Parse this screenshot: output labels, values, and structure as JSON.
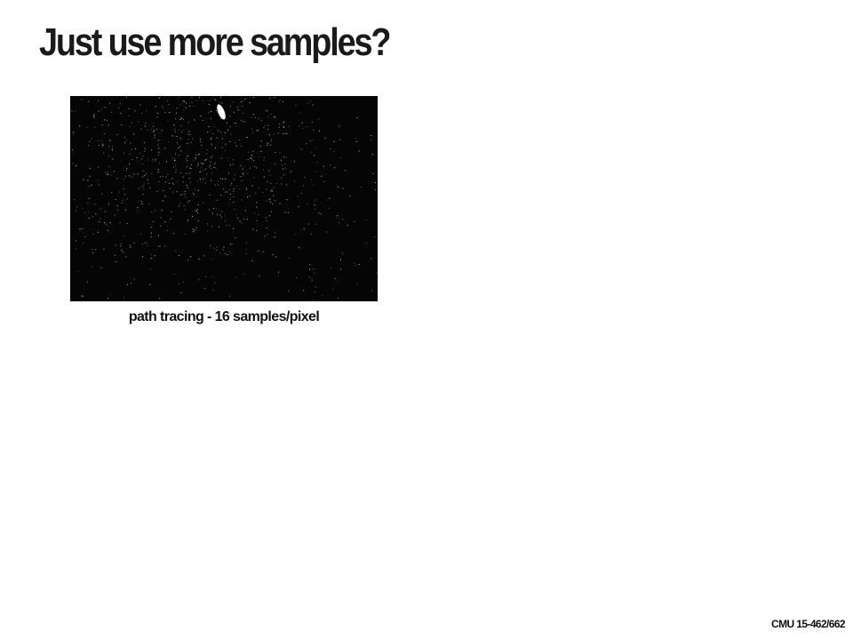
{
  "slide": {
    "title": "Just use more samples?",
    "caption": "path tracing - 16 samples/pixel",
    "footer": "CMU 15-462/662"
  },
  "image": {
    "description_icon": "noisy-path-traced-render",
    "background_color": "#050505",
    "noise_color": "#d8d8d8",
    "light_color": "#ffffff"
  }
}
